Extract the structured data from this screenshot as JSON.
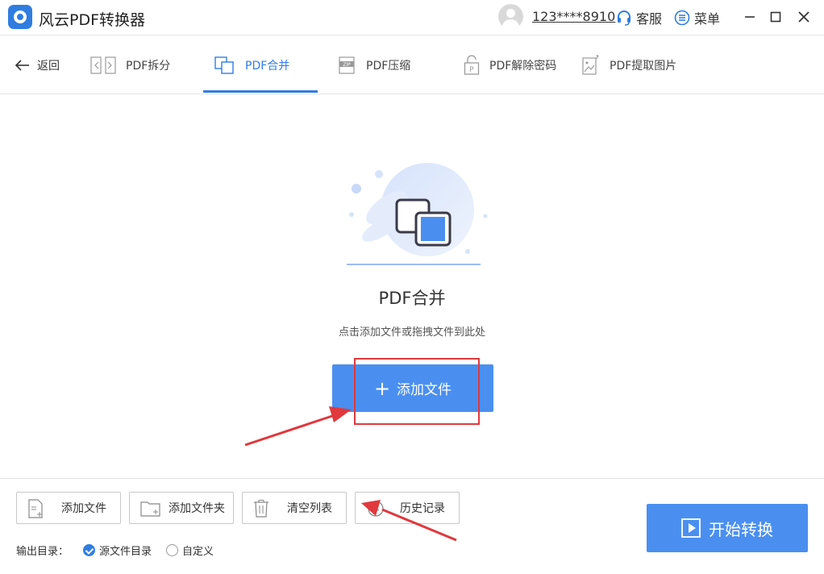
{
  "app": {
    "title": "风云PDF转换器"
  },
  "header": {
    "username": "123****8910",
    "service_label": "客服",
    "menu_label": "菜单"
  },
  "nav": {
    "back_label": "返回",
    "tabs": [
      {
        "label": "PDF拆分",
        "icon": "split-icon"
      },
      {
        "label": "PDF合并",
        "icon": "merge-icon",
        "active": true
      },
      {
        "label": "PDF压缩",
        "icon": "zip-icon"
      },
      {
        "label": "PDF解除密码",
        "icon": "unlock-icon"
      },
      {
        "label": "PDF提取图片",
        "icon": "image-extract-icon"
      }
    ]
  },
  "main": {
    "title": "PDF合并",
    "subtitle": "点击添加文件或拖拽文件到此处",
    "add_button_label": "添加文件"
  },
  "toolbar": {
    "add_file_label": "添加文件",
    "add_folder_label": "添加文件夹",
    "clear_list_label": "清空列表",
    "history_label": "历史记录"
  },
  "output": {
    "label": "输出目录：",
    "options": [
      {
        "label": "源文件目录",
        "selected": true
      },
      {
        "label": "自定义",
        "selected": false
      }
    ]
  },
  "start_button_label": "开始转换",
  "colors": {
    "accent": "#2f7de1",
    "button": "#4a8ff0",
    "annotation": "#e0393e"
  }
}
